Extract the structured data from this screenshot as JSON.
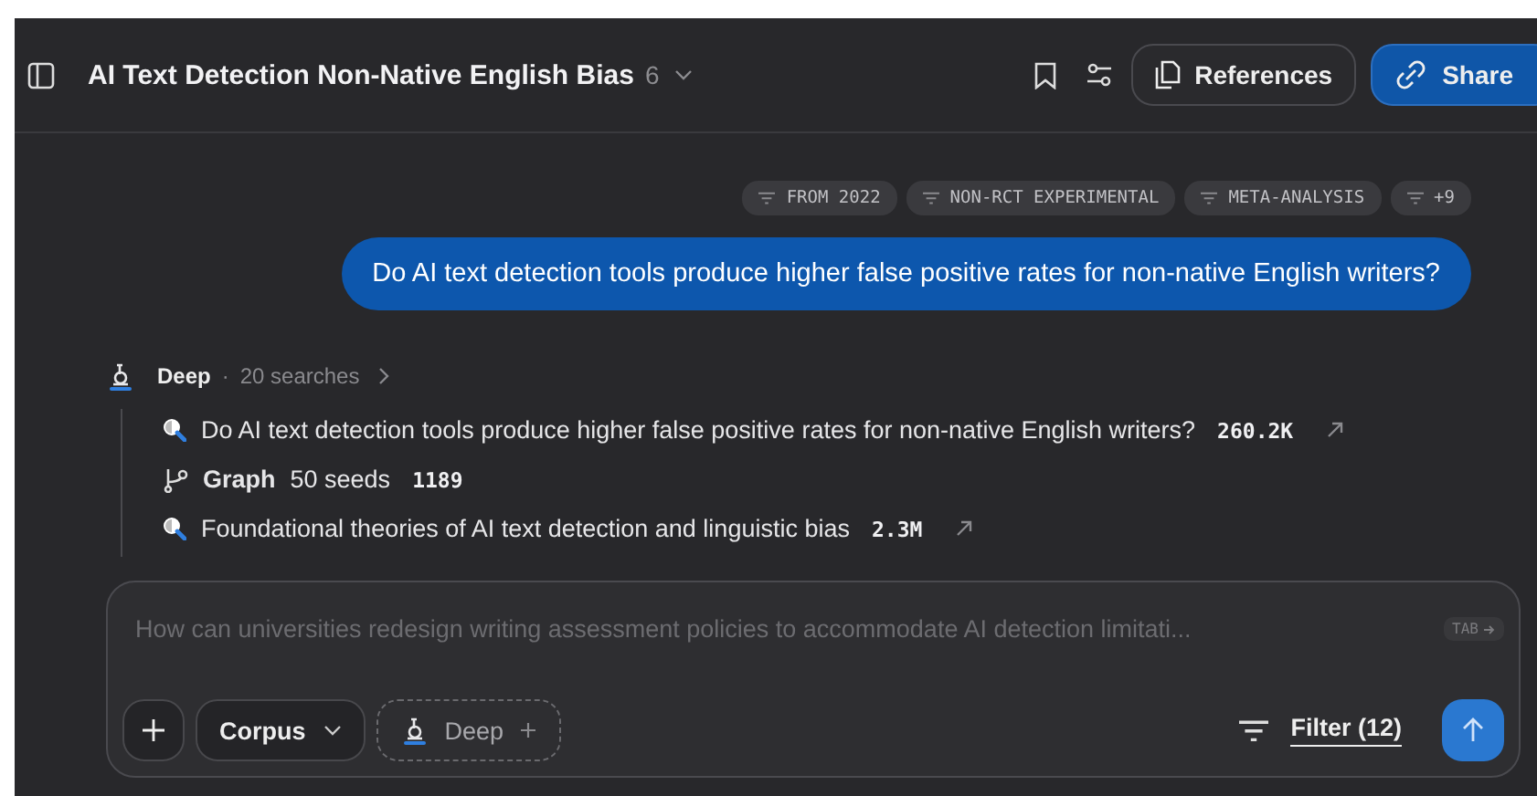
{
  "header": {
    "title": "AI Text Detection Non-Native English Bias",
    "count": "6",
    "buttons": [
      {
        "label": "References",
        "kind": "outline"
      },
      {
        "label": "Share",
        "kind": "primary"
      }
    ]
  },
  "filter_chips": [
    "FROM 2022",
    "NON-RCT EXPERIMENTAL",
    "META-ANALYSIS",
    "+9"
  ],
  "question": "Do AI text detection tools produce higher false positive rates for non-native English writers?",
  "run": {
    "mode": "Deep",
    "separator": "·",
    "detail": "20 searches",
    "steps": [
      {
        "kind": "search",
        "text": "Do AI text detection tools produce higher false positive rates for non-native English writers?",
        "count": "260.2K"
      },
      {
        "kind": "graph",
        "label": "Graph",
        "text": "50 seeds",
        "count": "1189"
      },
      {
        "kind": "search",
        "text": "Foundational theories of AI text detection and linguistic bias",
        "count": "2.3M"
      }
    ]
  },
  "composer": {
    "placeholder": "How can universities redesign writing assessment policies to accommodate AI detection limitati...",
    "hint": "TAB",
    "corpus": "Corpus",
    "mode": "Deep",
    "filter": "Filter (12)"
  }
}
